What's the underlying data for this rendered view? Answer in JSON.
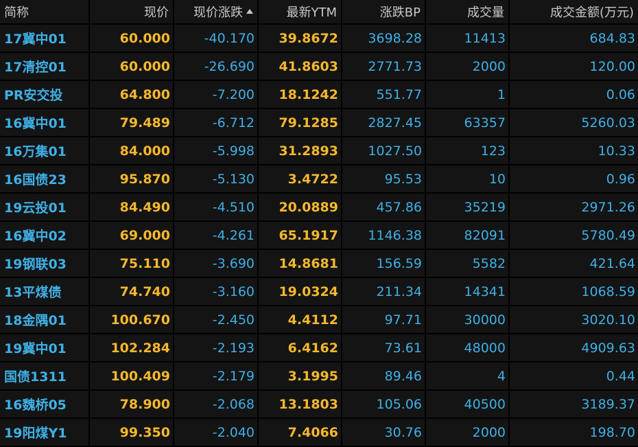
{
  "columns": {
    "name": "简称",
    "price": "现价",
    "change": "现价涨跌",
    "ytm": "最新YTM",
    "bp": "涨跌BP",
    "volume": "成交量",
    "amount": "成交金额(万元)"
  },
  "sort": {
    "column": "change",
    "direction": "ascending",
    "icon": "triangle-up-icon"
  },
  "colors": {
    "background": "#000000",
    "cell": "#141414",
    "blue": "#3fb0e6",
    "yellow": "#f5b82e",
    "header_text": "#c8c8c8"
  },
  "rows": [
    {
      "name": "17冀中01",
      "price": "60.000",
      "change": "-40.170",
      "ytm": "39.8672",
      "bp": "3698.28",
      "volume": "11413",
      "amount": "684.83"
    },
    {
      "name": "17清控01",
      "price": "60.000",
      "change": "-26.690",
      "ytm": "41.8603",
      "bp": "2771.73",
      "volume": "2000",
      "amount": "120.00"
    },
    {
      "name": "PR安交投",
      "price": "64.800",
      "change": "-7.200",
      "ytm": "18.1242",
      "bp": "551.77",
      "volume": "1",
      "amount": "0.06"
    },
    {
      "name": "16冀中01",
      "price": "79.489",
      "change": "-6.712",
      "ytm": "79.1285",
      "bp": "2827.45",
      "volume": "63357",
      "amount": "5260.03"
    },
    {
      "name": "16万集01",
      "price": "84.000",
      "change": "-5.998",
      "ytm": "31.2893",
      "bp": "1027.50",
      "volume": "123",
      "amount": "10.33"
    },
    {
      "name": "16国债23",
      "price": "95.870",
      "change": "-5.130",
      "ytm": "3.4722",
      "bp": "95.53",
      "volume": "10",
      "amount": "0.96"
    },
    {
      "name": "19云投01",
      "price": "84.490",
      "change": "-4.510",
      "ytm": "20.0889",
      "bp": "457.86",
      "volume": "35219",
      "amount": "2971.26"
    },
    {
      "name": "16冀中02",
      "price": "69.000",
      "change": "-4.261",
      "ytm": "65.1917",
      "bp": "1146.38",
      "volume": "82091",
      "amount": "5780.49"
    },
    {
      "name": "19钢联03",
      "price": "75.110",
      "change": "-3.690",
      "ytm": "14.8681",
      "bp": "156.59",
      "volume": "5582",
      "amount": "421.64"
    },
    {
      "name": "13平煤债",
      "price": "74.740",
      "change": "-3.160",
      "ytm": "19.0324",
      "bp": "211.34",
      "volume": "14341",
      "amount": "1068.59"
    },
    {
      "name": "18金隅01",
      "price": "100.670",
      "change": "-2.450",
      "ytm": "4.4112",
      "bp": "97.71",
      "volume": "30000",
      "amount": "3020.10"
    },
    {
      "name": "19冀中01",
      "price": "102.284",
      "change": "-2.193",
      "ytm": "6.4162",
      "bp": "73.61",
      "volume": "48000",
      "amount": "4909.63"
    },
    {
      "name": "国债1311",
      "price": "100.409",
      "change": "-2.179",
      "ytm": "3.1995",
      "bp": "89.46",
      "volume": "4",
      "amount": "0.44"
    },
    {
      "name": "16魏桥05",
      "price": "78.900",
      "change": "-2.068",
      "ytm": "13.1803",
      "bp": "105.06",
      "volume": "40500",
      "amount": "3189.37"
    },
    {
      "name": "19阳煤Y1",
      "price": "99.350",
      "change": "-2.040",
      "ytm": "7.4066",
      "bp": "30.76",
      "volume": "2000",
      "amount": "198.70"
    }
  ]
}
